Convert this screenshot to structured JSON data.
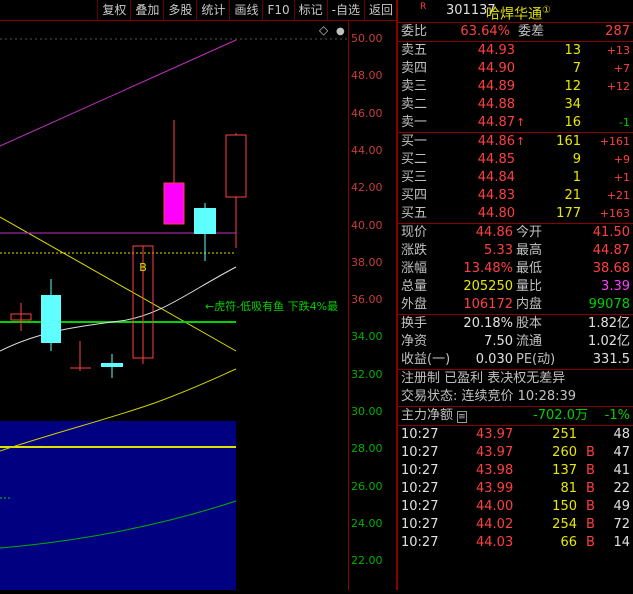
{
  "toolbar": [
    "复权",
    "叠加",
    "多股",
    "统计",
    "画线",
    "F10",
    "标记",
    "-自选",
    "返回"
  ],
  "header": {
    "badge": "R",
    "code": "301137",
    "name": "哈焊华通",
    "mark": "①"
  },
  "ratio": {
    "l1": "委比",
    "v1": "63.64%",
    "l2": "委差",
    "v2": "287"
  },
  "sell": [
    {
      "label": "卖五",
      "price": "44.93",
      "vol": "13",
      "chg": "+13"
    },
    {
      "label": "卖四",
      "price": "44.90",
      "vol": "7",
      "chg": "+7"
    },
    {
      "label": "卖三",
      "price": "44.89",
      "vol": "12",
      "chg": "+12"
    },
    {
      "label": "卖二",
      "price": "44.88",
      "vol": "34",
      "chg": ""
    },
    {
      "label": "卖一",
      "price": "44.87",
      "arrow": "↑",
      "vol": "16",
      "chg": "-1"
    }
  ],
  "buy": [
    {
      "label": "买一",
      "price": "44.86",
      "arrow": "↑",
      "vol": "161",
      "chg": "+161"
    },
    {
      "label": "买二",
      "price": "44.85",
      "vol": "9",
      "chg": "+9"
    },
    {
      "label": "买三",
      "price": "44.84",
      "vol": "1",
      "chg": "+1"
    },
    {
      "label": "买四",
      "price": "44.83",
      "vol": "21",
      "chg": "+21"
    },
    {
      "label": "买五",
      "price": "44.80",
      "vol": "177",
      "chg": "+163"
    }
  ],
  "stats": [
    {
      "l1": "现价",
      "v1": "44.86",
      "c1": "red",
      "l2": "今开",
      "v2": "41.50",
      "c2": "red"
    },
    {
      "l1": "涨跌",
      "v1": "5.33",
      "c1": "red",
      "l2": "最高",
      "v2": "44.87",
      "c2": "red"
    },
    {
      "l1": "涨幅",
      "v1": "13.48%",
      "c1": "red",
      "l2": "最低",
      "v2": "38.68",
      "c2": "red"
    },
    {
      "l1": "总量",
      "v1": "205250",
      "c1": "yel",
      "l2": "量比",
      "v2": "3.39",
      "c2": "mag"
    },
    {
      "l1": "外盘",
      "v1": "106172",
      "c1": "red",
      "l2": "内盘",
      "v2": "99078",
      "c2": "grn"
    }
  ],
  "stats2": [
    {
      "l1": "换手",
      "v1": "20.18%",
      "l2": "股本",
      "v2": "1.82亿"
    },
    {
      "l1": "净资",
      "v1": "7.50",
      "l2": "流通",
      "v2": "1.02亿"
    },
    {
      "l1": "收益(一)",
      "v1": "0.030",
      "l2": "PE(动)",
      "v2": "331.5"
    }
  ],
  "info1": "注册制 已盈利 表决权无差异",
  "info2": "交易状态: 连续竞价 10:28:39",
  "flow": {
    "label": "主力净额",
    "value": "-702.0万",
    "pct": "-1%"
  },
  "ticks": [
    {
      "t": "10:27",
      "p": "43.97",
      "v": "251",
      "s": "",
      "n": "48"
    },
    {
      "t": "10:27",
      "p": "43.97",
      "v": "260",
      "s": "B",
      "n": "47"
    },
    {
      "t": "10:27",
      "p": "43.98",
      "v": "137",
      "s": "B",
      "n": "41"
    },
    {
      "t": "10:27",
      "p": "43.99",
      "v": "81",
      "s": "B",
      "n": "22"
    },
    {
      "t": "10:27",
      "p": "44.00",
      "v": "150",
      "s": "B",
      "n": "49"
    },
    {
      "t": "10:27",
      "p": "44.02",
      "v": "254",
      "s": "B",
      "n": "72"
    },
    {
      "t": "10:27",
      "p": "44.03",
      "v": "66",
      "s": "B",
      "n": "14"
    }
  ],
  "axis": [
    "50.00",
    "48.00",
    "46.00",
    "44.00",
    "42.00",
    "40.00",
    "38.00",
    "36.00",
    "34.00",
    "32.00",
    "30.00",
    "28.00",
    "26.00",
    "24.00",
    "22.00"
  ],
  "chart": {
    "annotation": "←虎符-低吸有鱼 下跌4%最",
    "b_marker": "B",
    "diamond": "◇",
    "dot": "●"
  }
}
